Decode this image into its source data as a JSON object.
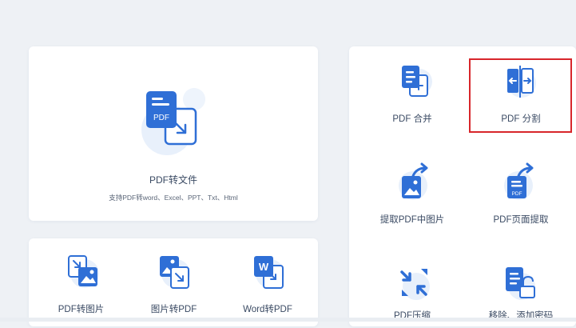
{
  "main_tool": {
    "label": "PDF转文件",
    "subtitle": "支持PDF转word、Excel、PPT、Txt、Html",
    "icon": "pdf-convert-icon",
    "badge": "PDF"
  },
  "bottom_tools": [
    {
      "label": "PDF转图片",
      "icon": "pdf-to-image-icon"
    },
    {
      "label": "图片转PDF",
      "icon": "image-to-pdf-icon"
    },
    {
      "label": "Word转PDF",
      "icon": "word-to-pdf-icon",
      "badge": "W"
    }
  ],
  "right_tools": [
    {
      "label": "PDF 合并",
      "icon": "pdf-merge-icon"
    },
    {
      "label": "PDF 分割",
      "icon": "pdf-split-icon"
    },
    {
      "label": "提取PDF中图片",
      "icon": "extract-image-icon"
    },
    {
      "label": "PDF页面提取",
      "icon": "page-extract-icon",
      "badge": "PDF"
    },
    {
      "label": "PDF压缩",
      "icon": "pdf-compress-icon"
    },
    {
      "label": "移除、添加密码",
      "icon": "password-lock-icon"
    }
  ],
  "colors": {
    "primary": "#2f6fd6",
    "icon_light": "#dbe8fa",
    "highlight": "#d8262b",
    "text": "#3a4a63"
  }
}
